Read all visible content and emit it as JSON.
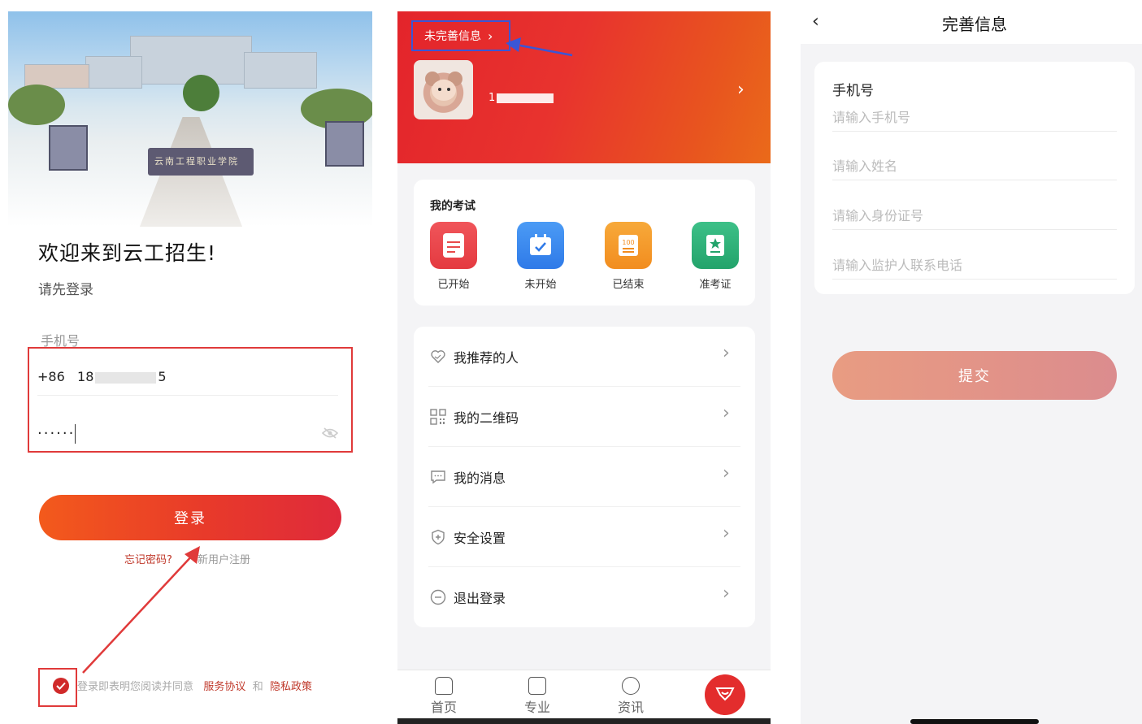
{
  "login": {
    "welcome": "欢迎来到云工招生!",
    "subtitle": "请先登录",
    "phone_label": "手机号",
    "country_code": "+86",
    "phone_prefix": "18",
    "phone_suffix": "5",
    "password_mask": "······",
    "login_button": "登录",
    "forgot_password": "忘记密码?",
    "register": "新用户注册",
    "consent_text": "登录即表明您阅读并同意",
    "service_agreement": "服务协议",
    "and": "和",
    "privacy_policy": "隐私政策",
    "gate_sign": "云南工程职业学院",
    "colors": {
      "primary": "#e8332e",
      "highlight_box": "#e03a3a"
    }
  },
  "profile": {
    "incomplete_info": "未完善信息",
    "username_prefix": "1",
    "exam_section_title": "我的考试",
    "exam_items": [
      {
        "label": "已开始",
        "icon": "document-icon",
        "color": "#f0555a"
      },
      {
        "label": "未开始",
        "icon": "calendar-check-icon",
        "color": "#3f8cf0"
      },
      {
        "label": "已结束",
        "icon": "score-100-icon",
        "color": "#f59a2a"
      },
      {
        "label": "准考证",
        "icon": "admission-ticket-icon",
        "color": "#2fb37a"
      }
    ],
    "menu_items": [
      {
        "label": "我推荐的人",
        "icon": "heart-handshake-icon"
      },
      {
        "label": "我的二维码",
        "icon": "qr-code-icon"
      },
      {
        "label": "我的消息",
        "icon": "message-icon"
      },
      {
        "label": "安全设置",
        "icon": "shield-icon"
      },
      {
        "label": "退出登录",
        "icon": "logout-icon"
      }
    ],
    "tabs": [
      {
        "label": "首页",
        "icon": "home-icon"
      },
      {
        "label": "专业",
        "icon": "book-icon"
      },
      {
        "label": "资讯",
        "icon": "news-icon"
      }
    ],
    "fab_icon": "mine-icon",
    "colors": {
      "header_start": "#e3242b",
      "header_end": "#ea6a1a",
      "annotation_box": "#3a56d6"
    }
  },
  "info_form": {
    "title": "完善信息",
    "phone_label": "手机号",
    "placeholders": {
      "phone": "请输入手机号",
      "name": "请输入姓名",
      "id_number": "请输入身份证号",
      "guardian_phone": "请输入监护人联系电话"
    },
    "submit": "提交"
  }
}
